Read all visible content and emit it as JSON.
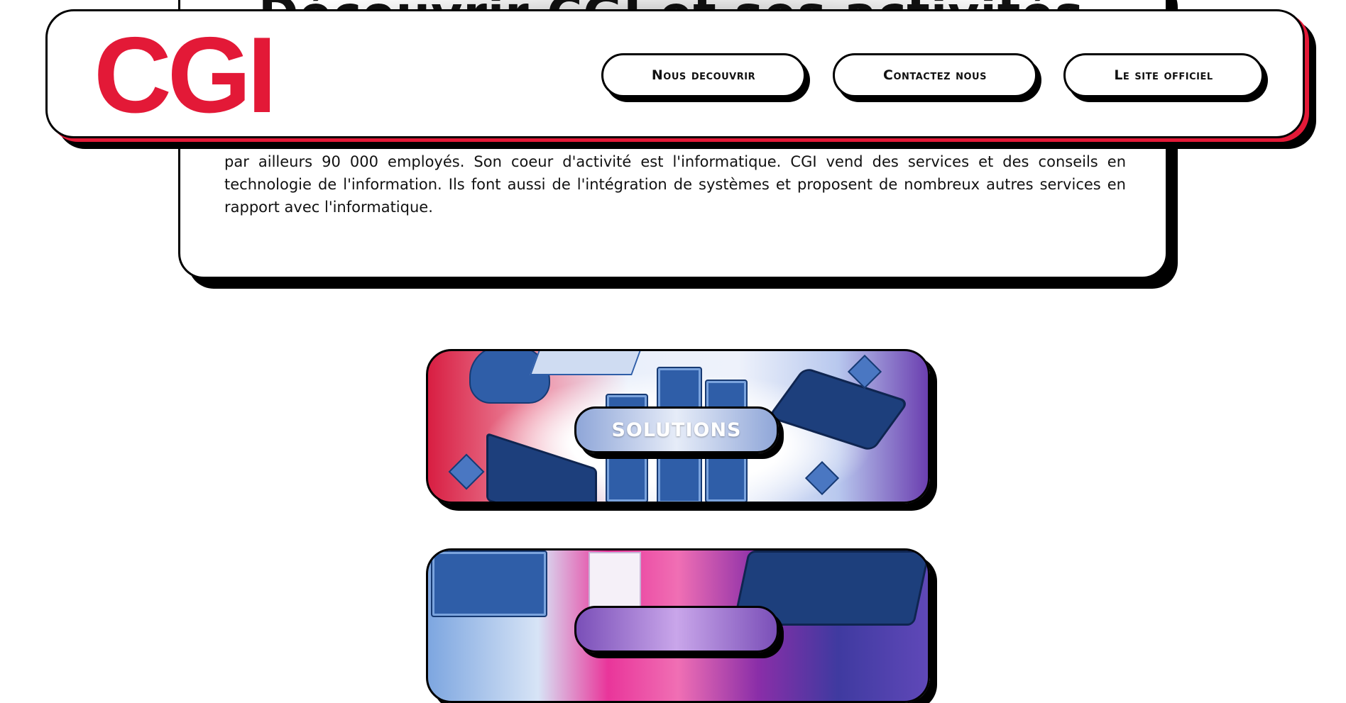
{
  "header": {
    "logo_text": "CGI",
    "nav": [
      {
        "label": "Nous decouvrir"
      },
      {
        "label": "Contactez nous"
      },
      {
        "label": "Le site officiel"
      }
    ]
  },
  "about": {
    "title": "Découvrir CGI et ses activités",
    "text": "par ailleurs 90 000 employés. Son coeur d'activité est l'informatique. CGI vend des services et des conseils en technologie de l'information. Ils font aussi de l'intégration de systèmes et proposent de nombreux autres services en rapport avec l'informatique."
  },
  "tiles": [
    {
      "label": "SOLUTIONS"
    },
    {
      "label": ""
    }
  ],
  "colors": {
    "brand_red": "#e31937",
    "border": "#000000"
  }
}
